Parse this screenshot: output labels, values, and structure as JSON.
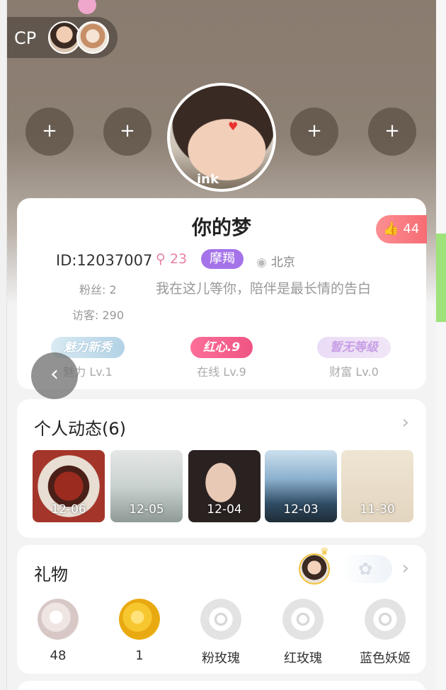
{
  "header": {
    "cp_label": "CP",
    "seat_plus": "+"
  },
  "profile": {
    "nickname": "你的梦",
    "likes": "44",
    "user_id": "ID:12037007",
    "charm": "23",
    "zodiac": "摩羯",
    "location": "北京",
    "fans": "粉丝: 2",
    "bio": "我在这儿等你，陪伴是最长情的告白",
    "visitors": "访客: 290",
    "avatar_tag": "ink",
    "levels": [
      {
        "badge": "魅力新秀",
        "label": "魅力 Lv.1"
      },
      {
        "badge": "红心.9",
        "label": "在线 Lv.9"
      },
      {
        "badge": "暂无等级",
        "label": "财富 Lv.0"
      }
    ]
  },
  "moments": {
    "title": "个人动态(6)",
    "items": [
      {
        "date": "12-06"
      },
      {
        "date": "12-05"
      },
      {
        "date": "12-04"
      },
      {
        "date": "12-03"
      },
      {
        "date": "11-30"
      }
    ]
  },
  "gifts": {
    "title": "礼物",
    "items": [
      {
        "name": "48"
      },
      {
        "name": "1"
      },
      {
        "name": "粉玫瑰"
      },
      {
        "name": "红玫瑰"
      },
      {
        "name": "蓝色妖姬"
      }
    ]
  },
  "colors": {
    "zodiac_bg": "#a573e9",
    "like_bg": "#f76c74",
    "badge_red": "#f05583"
  }
}
